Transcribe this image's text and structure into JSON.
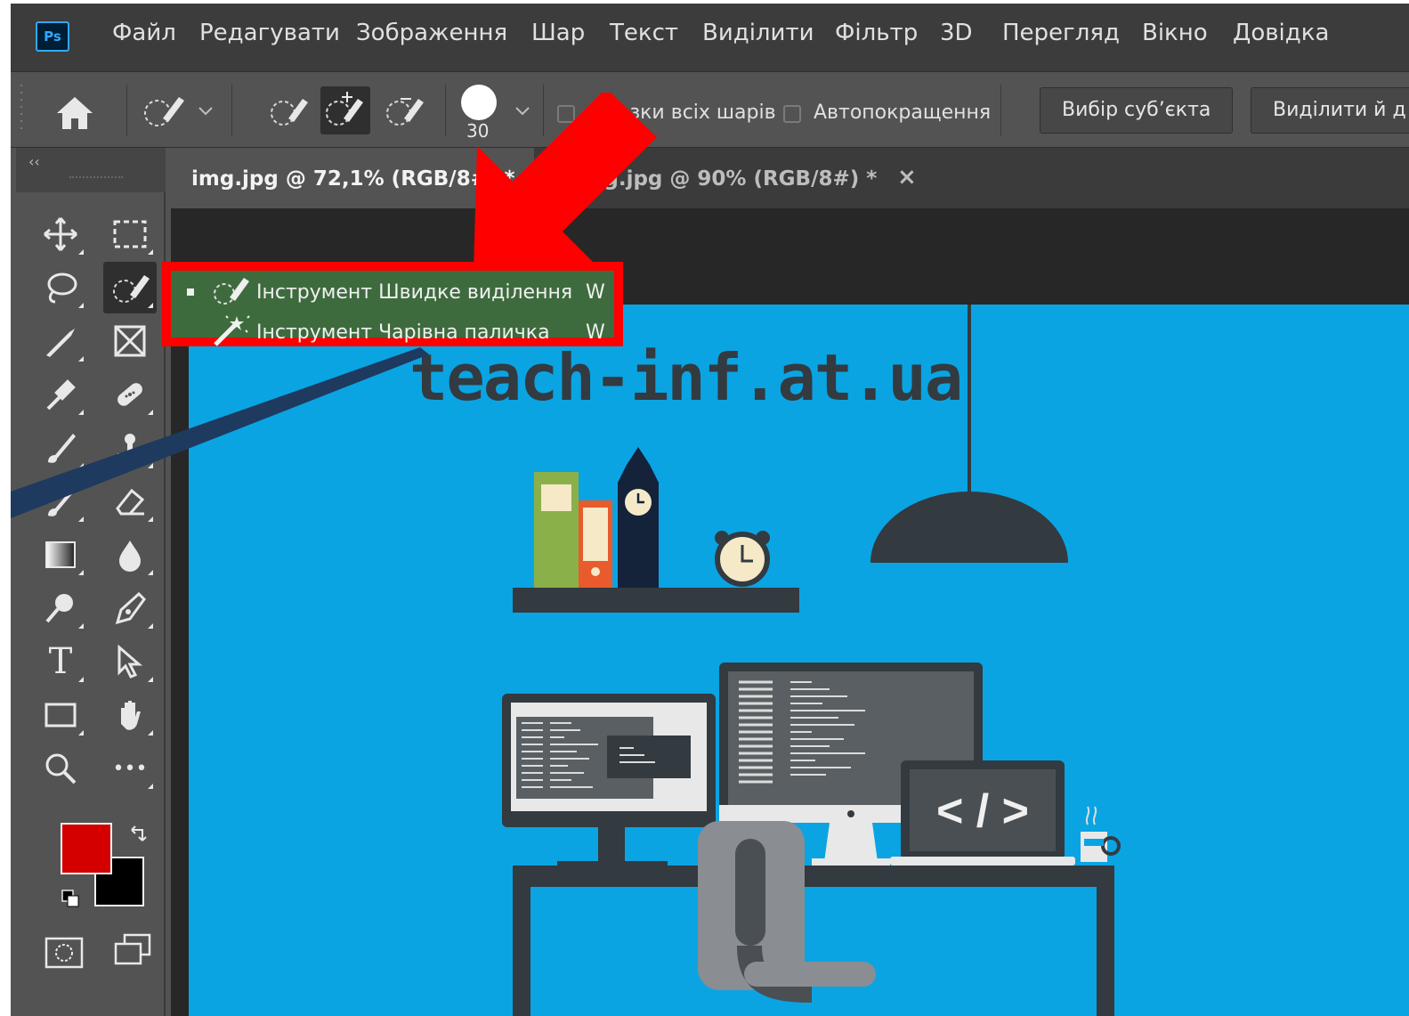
{
  "app": {
    "logo_text": "Ps",
    "menu": [
      "Файл",
      "Редагувати",
      "Зображення",
      "Шар",
      "Текст",
      "Виділити",
      "Фільтр",
      "3D",
      "Перегляд",
      "Вікно",
      "Довідка"
    ]
  },
  "options": {
    "brush_size": "30",
    "sample_all_layers": "разки всіх шарів",
    "auto_enhance": "Автопокращення",
    "select_subject": "Вибір суб’єкта",
    "select_and_mask": "Виділити й д"
  },
  "tabs": [
    {
      "label": "img.jpg @ 72,1% (RGB/8#) *"
    },
    {
      "label": "ng.jpg @ 90% (RGB/8#) *",
      "close": "×"
    }
  ],
  "flyout": {
    "items": [
      {
        "label": "Інструмент Швидке виділення",
        "key": "W",
        "icon": "quick-selection-icon",
        "active": true
      },
      {
        "label": "Інструмент Чарівна паличка",
        "key": "W",
        "icon": "magic-wand-icon",
        "active": false
      }
    ]
  },
  "canvas": {
    "watermark": "teach-inf.at.ua",
    "code_symbol": "< / >"
  },
  "colors": {
    "foreground": "#d40000",
    "background": "#000000",
    "highlight": "#ff0000",
    "canvas_bg": "#0aa4e3"
  },
  "toolbar": {
    "collapse": "‹‹",
    "tools": [
      "move-tool",
      "marquee-tool",
      "lasso-tool",
      "quick-selection-tool",
      "crop-tool",
      "frame-tool",
      "eyedropper-tool",
      "healing-tool",
      "brush-tool",
      "stamp-tool",
      "history-brush-tool",
      "eraser-tool",
      "gradient-tool",
      "blur-tool",
      "dodge-tool",
      "pen-tool",
      "type-tool",
      "path-selection-tool",
      "rectangle-tool",
      "hand-tool",
      "zoom-tool",
      "more-tools",
      "quick-mask",
      "screen-mode"
    ],
    "type_glyph": "T",
    "more_glyph": "•••"
  }
}
